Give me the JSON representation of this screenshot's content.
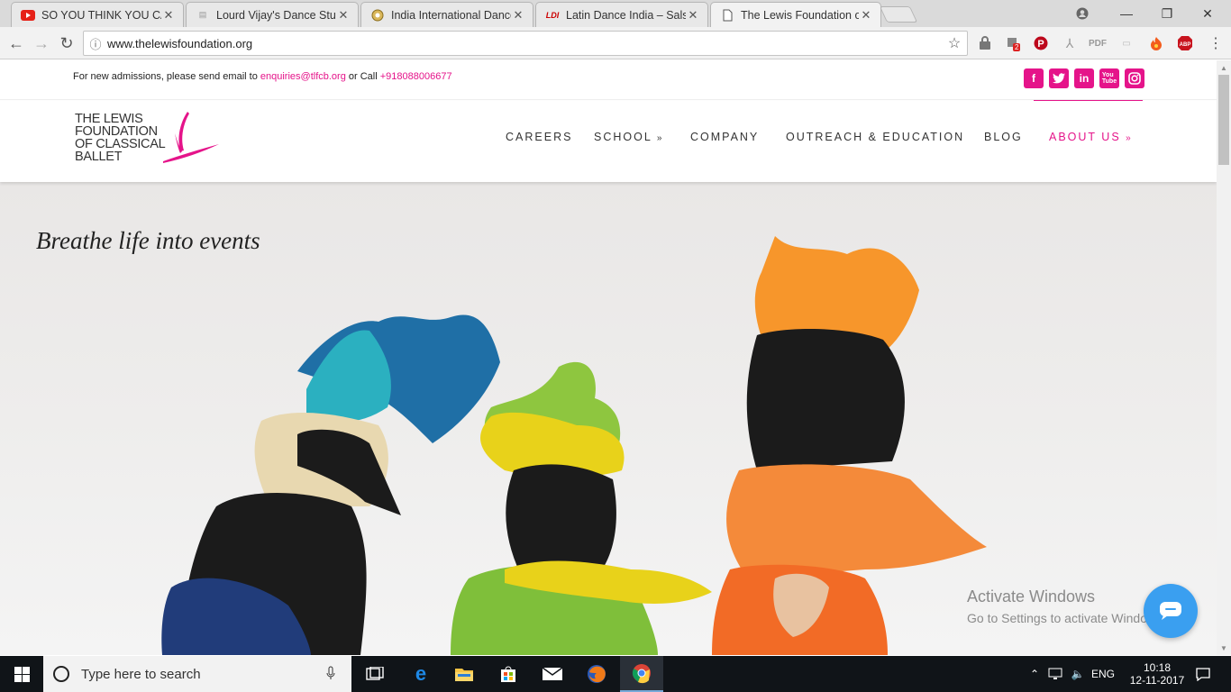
{
  "browser": {
    "tabs": [
      {
        "title": "SO YOU THINK YOU CAN",
        "active": false,
        "favicon": "youtube-icon"
      },
      {
        "title": "Lourd Vijay's Dance Stud",
        "active": false,
        "favicon": "page-icon"
      },
      {
        "title": "India International Dance",
        "active": false,
        "favicon": "iidc-icon"
      },
      {
        "title": "Latin Dance India – Salsa",
        "active": false,
        "favicon": "ldi-icon"
      },
      {
        "title": "The Lewis Foundation of",
        "active": true,
        "favicon": "document-icon"
      }
    ],
    "url": "www.thelewisfoundation.org"
  },
  "site": {
    "admission": {
      "prefix": "For new admissions, please send email to ",
      "email": "enquiries@tlfcb.org",
      "middle": " or Call ",
      "phone": "+918088006677"
    },
    "social": [
      "facebook-icon",
      "twitter-icon",
      "linkedin-icon",
      "youtube-icon",
      "instagram-icon"
    ],
    "logo_lines": [
      "THE LEWIS",
      "FOUNDATION",
      "OF CLASSICAL",
      "BALLET"
    ],
    "nav": [
      {
        "label": "CAREERS",
        "dropdown": false,
        "active": false
      },
      {
        "label": "SCHOOL",
        "dropdown": true,
        "active": false
      },
      {
        "label": "COMPANY",
        "dropdown": false,
        "active": false
      },
      {
        "label": "OUTREACH & EDUCATION",
        "dropdown": false,
        "active": false
      },
      {
        "label": "BLOG",
        "dropdown": false,
        "active": false
      },
      {
        "label": "ABOUT US",
        "dropdown": true,
        "active": true
      }
    ],
    "hero_tagline": "Breathe life into events",
    "accent_color": "#e5148a"
  },
  "watermark": {
    "line1": "Activate Windows",
    "line2": "Go to Settings to activate Windows."
  },
  "taskbar": {
    "search_placeholder": "Type here to search",
    "language": "ENG",
    "time": "10:18",
    "date": "12-11-2017"
  },
  "extensions": {
    "badge_count": "2"
  }
}
